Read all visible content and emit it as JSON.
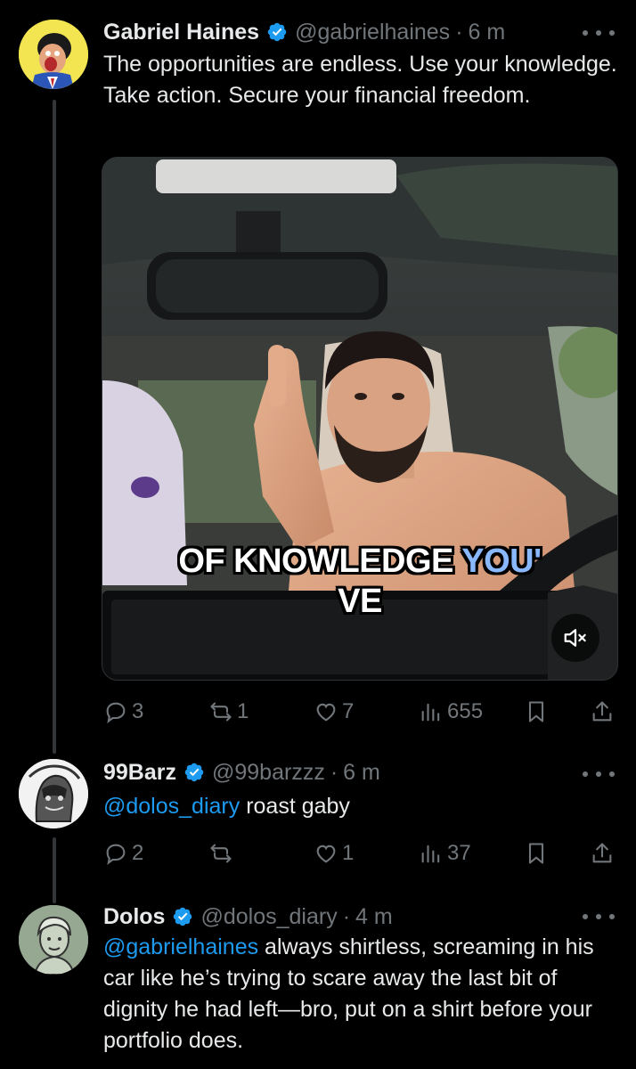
{
  "theme": {
    "background": "#000000",
    "text": "#e7e9ea",
    "secondary": "#71767b",
    "accent": "#1d9bf0",
    "verified": "#1d9bf0"
  },
  "posts": [
    {
      "name": "Gabriel Haines",
      "handle": "@gabrielhaines",
      "separator": "·",
      "time": "6 m",
      "verified": true,
      "avatar_icon": "cartoon-avatar-icon",
      "text": "The opportunities are endless. Use your knowledge. Take action.  Secure your financial freedom.",
      "media": {
        "type": "video",
        "caption_main": "OF KNOWLEDGE ",
        "caption_highlight": "YOU'",
        "caption_line2": "VE",
        "muted": true,
        "mute_icon": "volume-muted-icon"
      },
      "stats": {
        "replies": "3",
        "reposts": "1",
        "likes": "7",
        "views": "655"
      }
    },
    {
      "name": "99Barz",
      "handle": "@99barzzz",
      "separator": "·",
      "time": "6 m",
      "verified": true,
      "avatar_icon": "sketch-avatar-icon",
      "mention": "@dolos_diary",
      "text": " roast gaby",
      "stats": {
        "replies": "2",
        "reposts": "",
        "likes": "1",
        "views": "37"
      }
    },
    {
      "name": "Dolos",
      "handle": "@dolos_diary",
      "separator": "·",
      "time": "4 m",
      "verified": true,
      "avatar_icon": "portrait-avatar-icon",
      "mention": "@gabrielhaines",
      "text": " always shirtless, screaming in his car like he’s trying to scare away the last bit of dignity he had left—bro, put on a shirt before your portfolio does."
    }
  ]
}
